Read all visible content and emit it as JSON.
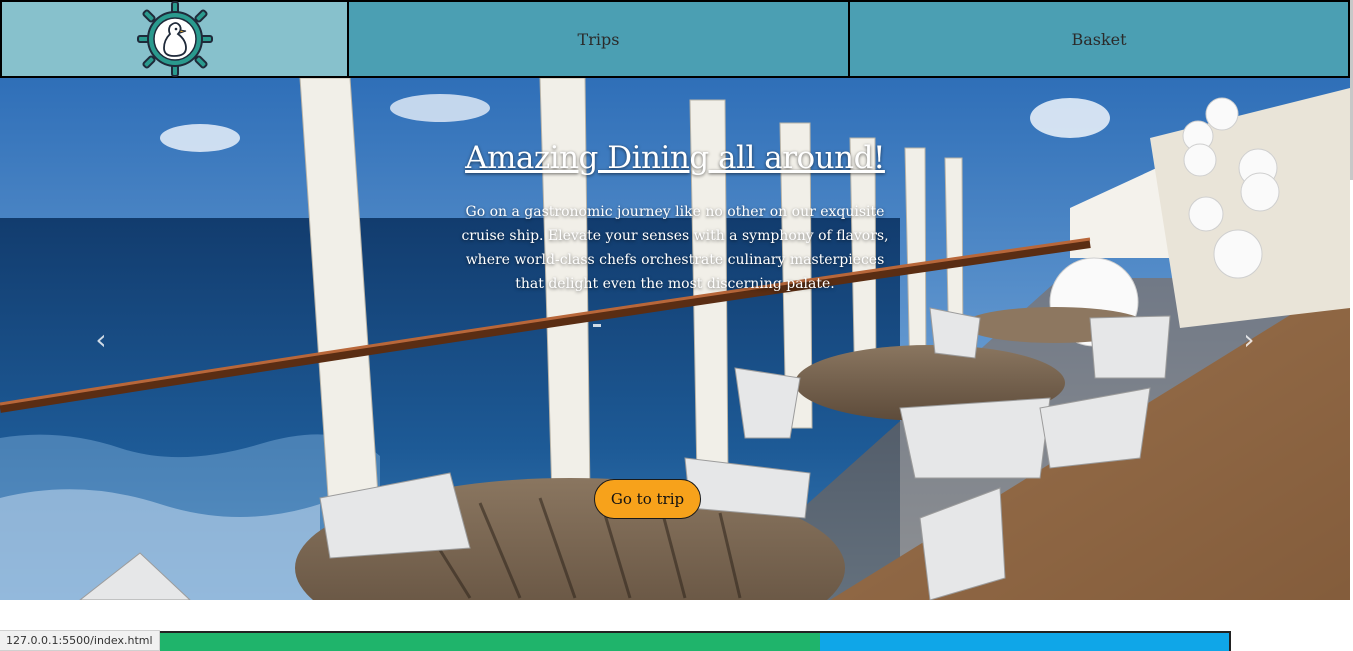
{
  "nav": {
    "logo_icon": "ship-wheel-bird-icon",
    "trips_label": "Trips",
    "basket_label": "Basket"
  },
  "hero": {
    "title": "Amazing Dining all around!",
    "text": "Go on a gastronomic journey like no other on our exquisite cruise ship. Elevate your senses with a symphony of flavors, where world-class chefs orchestrate culinary masterpieces that delight even the most discerning palate.",
    "cta_label": "Go to trip",
    "prev_icon": "chevron-left-icon",
    "next_icon": "chevron-right-icon"
  },
  "status_bar": {
    "url": "127.0.0.1:5500/index.html"
  },
  "colors": {
    "nav_logo_bg": "#87c1cc",
    "nav_bg": "#4b9fb3",
    "cta_bg": "#f7a21b",
    "strip_green": "#1fb46b",
    "strip_blue": "#0fa6e8"
  }
}
